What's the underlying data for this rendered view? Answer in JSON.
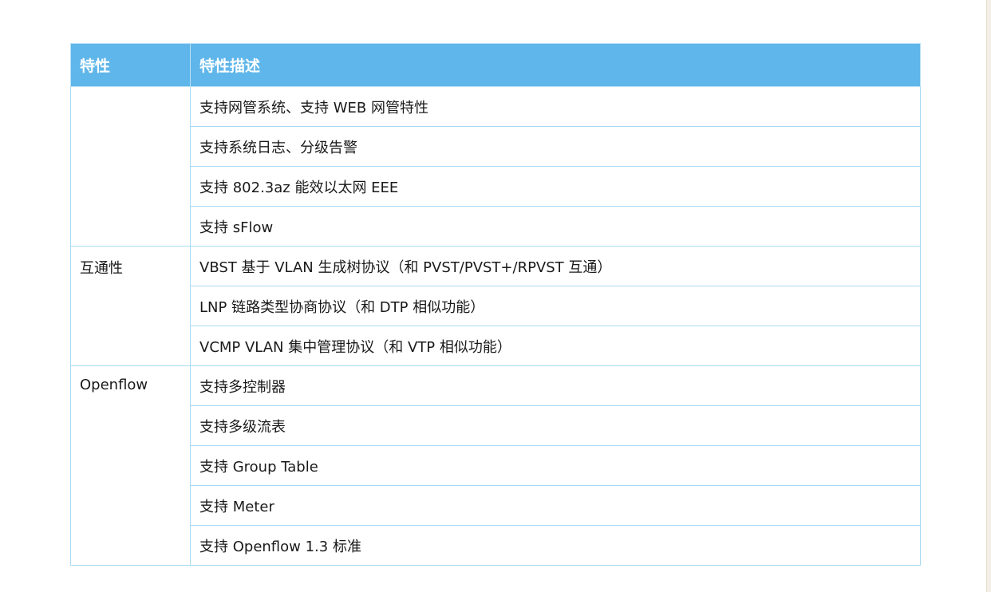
{
  "table": {
    "headers": [
      "特性",
      "特性描述"
    ],
    "groups": [
      {
        "feature": "",
        "rows": [
          "支持网管系统、支持 WEB 网管特性",
          "支持系统日志、分级告警",
          "支持 802.3az 能效以太网 EEE",
          "支持 sFlow"
        ]
      },
      {
        "feature": "互通性",
        "rows": [
          "VBST 基于 VLAN 生成树协议（和 PVST/PVST+/RPVST 互通）",
          "LNP 链路类型协商协议（和 DTP 相似功能）",
          "VCMP VLAN 集中管理协议（和 VTP 相似功能）"
        ]
      },
      {
        "feature": "Openflow",
        "rows": [
          "支持多控制器",
          "支持多级流表",
          "支持 Group Table",
          "支持 Meter",
          "支持 Openflow 1.3 标准"
        ]
      }
    ]
  },
  "colors": {
    "header_bg": "#5fb6ea",
    "header_text": "#ffffff",
    "grid_border": "#a9daf3"
  }
}
